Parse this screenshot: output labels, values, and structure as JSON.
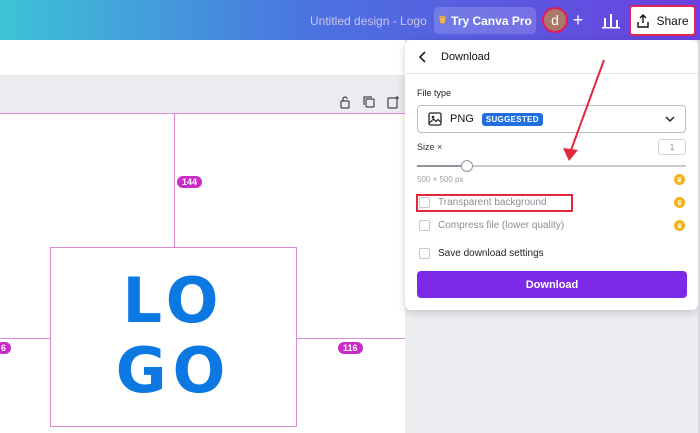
{
  "topbar": {
    "design_title": "Untitled design - Logo",
    "try_pro_label": "Try Canva Pro",
    "avatar_initial": "d",
    "plus_label": "+",
    "share_label": "Share"
  },
  "canvas": {
    "logo_line1": "LO",
    "logo_line2": "GO",
    "badge_top": "144",
    "badge_right": "116",
    "badge_left": "6",
    "logo_color": "#0c78e2",
    "guide_color": "#dd8cd8"
  },
  "download_panel": {
    "title": "Download",
    "file_type_label": "File type",
    "file_type_value": "PNG",
    "suggested_badge": "SUGGESTED",
    "size_label": "Size ×",
    "size_value": "1",
    "size_px": "500 × 500 px",
    "transparent_bg_label": "Transparent background",
    "compress_label": "Compress file (lower quality)",
    "save_settings_label": "Save download settings",
    "download_button": "Download",
    "accent_color": "#7d2ae8"
  },
  "icons": [
    "crown-icon",
    "plus-icon",
    "stats-icon",
    "share-icon",
    "back-icon",
    "image-icon",
    "chevron-down-icon",
    "lock-icon",
    "duplicate-icon",
    "add-page-icon"
  ]
}
